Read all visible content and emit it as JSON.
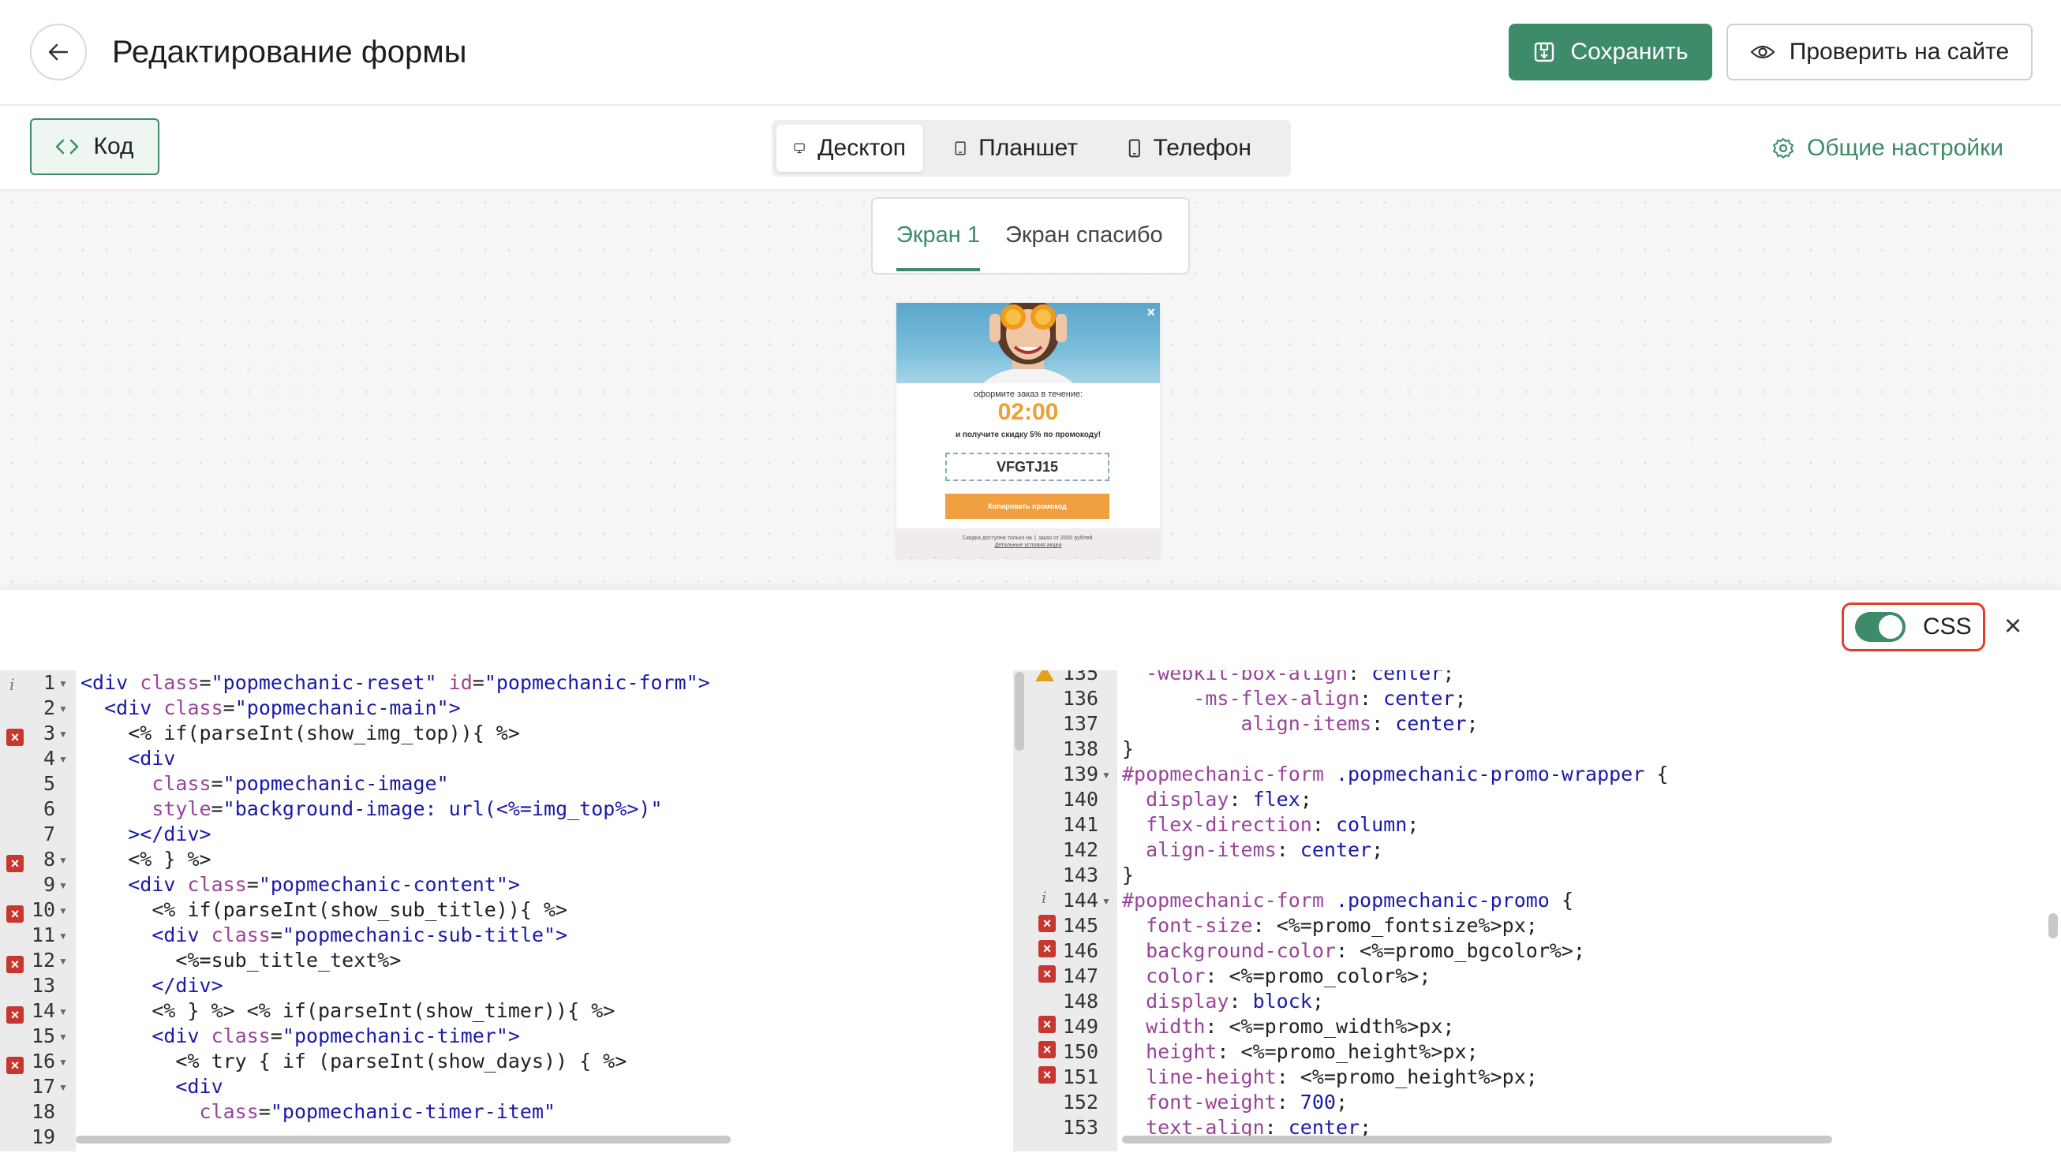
{
  "header": {
    "title": "Редактирование формы",
    "save_label": "Сохранить",
    "check_label": "Проверить на сайте"
  },
  "toolbar": {
    "code_label": "Код",
    "devices": [
      "Десктоп",
      "Планшет",
      "Телефон"
    ],
    "active_device": "Десктоп",
    "settings_label": "Общие настройки"
  },
  "screens": {
    "tabs": [
      "Экран 1",
      "Экран спасибо"
    ],
    "active": "Экран 1"
  },
  "preview": {
    "subtitle": "оформите заказ в течение:",
    "timer": "02:00",
    "discount_text": "и получите скидку 5% по промокоду!",
    "promo_code": "VFGTJ15",
    "copy_button": "Копировать промокод",
    "footer_line1": "Скидка доступна только на 1 заказ от 2000 рублей.",
    "footer_line2": "Детальные условия акции"
  },
  "code_panel": {
    "css_toggle_label": "CSS",
    "css_toggle_on": true
  },
  "colors": {
    "accent": "#3d8b68",
    "annotation": "#e0402a",
    "timer": "#f0a030"
  }
}
